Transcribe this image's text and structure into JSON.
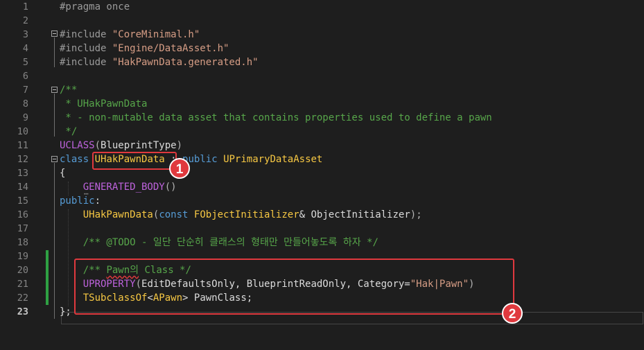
{
  "editor": {
    "active_line": "23",
    "lines": [
      {
        "num": "1",
        "tokens": [
          {
            "t": "#pragma once",
            "c": "pp"
          }
        ]
      },
      {
        "num": "2",
        "tokens": []
      },
      {
        "num": "3",
        "tokens": [
          {
            "t": "#include ",
            "c": "pp"
          },
          {
            "t": "\"CoreMinimal.h\"",
            "c": "str"
          }
        ]
      },
      {
        "num": "4",
        "tokens": [
          {
            "t": "#include ",
            "c": "pp"
          },
          {
            "t": "\"Engine/DataAsset.h\"",
            "c": "str"
          }
        ]
      },
      {
        "num": "5",
        "tokens": [
          {
            "t": "#include ",
            "c": "pp"
          },
          {
            "t": "\"HakPawnData.generated.h\"",
            "c": "str"
          }
        ]
      },
      {
        "num": "6",
        "tokens": []
      },
      {
        "num": "7",
        "tokens": [
          {
            "t": "/**",
            "c": "cm"
          }
        ]
      },
      {
        "num": "8",
        "tokens": [
          {
            "t": " * UHakPawnData",
            "c": "cm"
          }
        ]
      },
      {
        "num": "9",
        "tokens": [
          {
            "t": " * - non-mutable data asset that contains properties used to define a pawn",
            "c": "cm"
          }
        ]
      },
      {
        "num": "10",
        "tokens": [
          {
            "t": " */",
            "c": "cm"
          }
        ]
      },
      {
        "num": "11",
        "tokens": [
          {
            "t": "UCLASS",
            "c": "mac"
          },
          {
            "t": "(",
            "c": "par"
          },
          {
            "t": "BlueprintType",
            "c": "pl"
          },
          {
            "t": ")",
            "c": "par"
          }
        ]
      },
      {
        "num": "12",
        "tokens": [
          {
            "t": "class",
            "c": "kw"
          },
          {
            "t": " ",
            "c": "pl"
          },
          {
            "t": "UHakPawnData",
            "c": "cls"
          },
          {
            "t": " : ",
            "c": "pl"
          },
          {
            "t": "public",
            "c": "kw"
          },
          {
            "t": " ",
            "c": "pl"
          },
          {
            "t": "UPrimaryDataAsset",
            "c": "cls"
          }
        ]
      },
      {
        "num": "13",
        "tokens": [
          {
            "t": "{",
            "c": "pl"
          }
        ]
      },
      {
        "num": "14",
        "tokens": [
          {
            "t": "    ",
            "c": "pl"
          },
          {
            "t": "GENERATED_BODY",
            "c": "mac"
          },
          {
            "t": "()",
            "c": "par"
          }
        ]
      },
      {
        "num": "15",
        "tokens": [
          {
            "t": "public",
            "c": "kw"
          },
          {
            "t": ":",
            "c": "pl"
          }
        ]
      },
      {
        "num": "16",
        "tokens": [
          {
            "t": "    ",
            "c": "pl"
          },
          {
            "t": "UHakPawnData",
            "c": "cls"
          },
          {
            "t": "(",
            "c": "par"
          },
          {
            "t": "const",
            "c": "kw"
          },
          {
            "t": " ",
            "c": "pl"
          },
          {
            "t": "FObjectInitializer",
            "c": "cls"
          },
          {
            "t": "& ",
            "c": "pl"
          },
          {
            "t": "ObjectInitializer",
            "c": "pl"
          },
          {
            "t": ");",
            "c": "par"
          }
        ]
      },
      {
        "num": "17",
        "tokens": []
      },
      {
        "num": "18",
        "tokens": [
          {
            "t": "    ",
            "c": "pl"
          },
          {
            "t": "/** @TODO - 일단 단순히 클래스의 형태만 만들어놓도록 하자 */",
            "c": "cm"
          }
        ]
      },
      {
        "num": "19",
        "tokens": []
      },
      {
        "num": "20",
        "tokens": [
          {
            "t": "    ",
            "c": "pl"
          },
          {
            "t": "/** ",
            "c": "cm"
          },
          {
            "t": "Pawn의",
            "c": "cm",
            "s": true
          },
          {
            "t": " Class */",
            "c": "cm"
          }
        ]
      },
      {
        "num": "21",
        "tokens": [
          {
            "t": "    ",
            "c": "pl"
          },
          {
            "t": "UPROPERTY",
            "c": "mac"
          },
          {
            "t": "(",
            "c": "par"
          },
          {
            "t": "EditDefaultsOnly, BlueprintReadOnly, Category=",
            "c": "pl"
          },
          {
            "t": "\"Hak|Pawn\"",
            "c": "str"
          },
          {
            "t": ")",
            "c": "par"
          }
        ]
      },
      {
        "num": "22",
        "tokens": [
          {
            "t": "    ",
            "c": "pl"
          },
          {
            "t": "TSubclassOf",
            "c": "cls"
          },
          {
            "t": "<",
            "c": "pl"
          },
          {
            "t": "APawn",
            "c": "cls"
          },
          {
            "t": "> ",
            "c": "pl"
          },
          {
            "t": "PawnClass",
            "c": "pl"
          },
          {
            "t": ";",
            "c": "pl"
          }
        ]
      },
      {
        "num": "23",
        "tokens": [
          {
            "t": "};",
            "c": "pl"
          }
        ]
      }
    ]
  },
  "annotations": [
    {
      "label": "1"
    },
    {
      "label": "2"
    }
  ],
  "colors": {
    "background": "#1e1e1e",
    "keyword": "#569cd6",
    "comment": "#57a64a",
    "string": "#d69d85",
    "class": "#f7c843",
    "macro": "#be63dd",
    "annotation_red": "#e0393e",
    "change_bar": "#2ea043"
  }
}
